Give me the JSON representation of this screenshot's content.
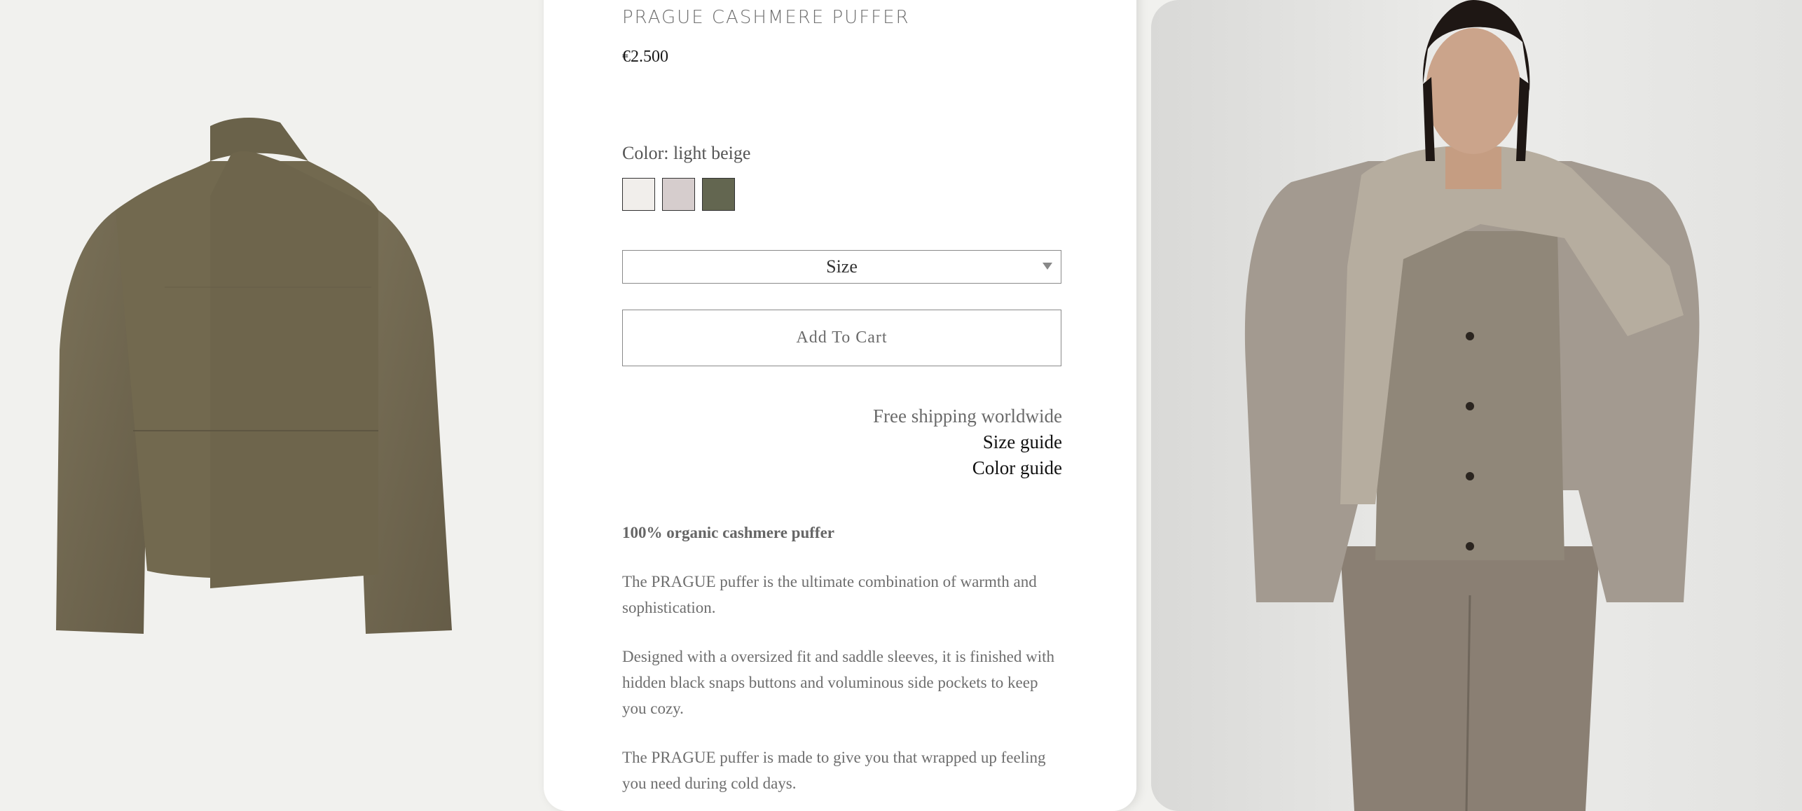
{
  "product": {
    "title": "PRAGUE CASHMERE PUFFER",
    "price": "€2.500",
    "color_label": "Color: light beige",
    "swatches": [
      {
        "name": "light beige",
        "hex": "#f1eeeb"
      },
      {
        "name": "mauve grey",
        "hex": "#d6cdcd"
      },
      {
        "name": "olive",
        "hex": "#636650"
      }
    ],
    "size_placeholder": "Size",
    "add_to_cart": "Add To Cart"
  },
  "links": {
    "shipping": "Free shipping worldwide",
    "size_guide": "Size guide",
    "color_guide": "Color guide"
  },
  "description": {
    "headline": "100% organic cashmere puffer",
    "p1": "The PRAGUE puffer is the ultimate combination of warmth and sophistication.",
    "p2": "Designed with a oversized fit and saddle sleeves, it is finished with  hidden black snaps buttons and voluminous side pockets to keep you cozy.",
    "p3": "The PRAGUE puffer is made to give you that wrapped up feeling you need during cold days."
  },
  "colors": {
    "background": "#f1f1ee",
    "panel": "#ffffff",
    "jacket": "#6f6650",
    "model_bg": "#e4e4e2"
  }
}
